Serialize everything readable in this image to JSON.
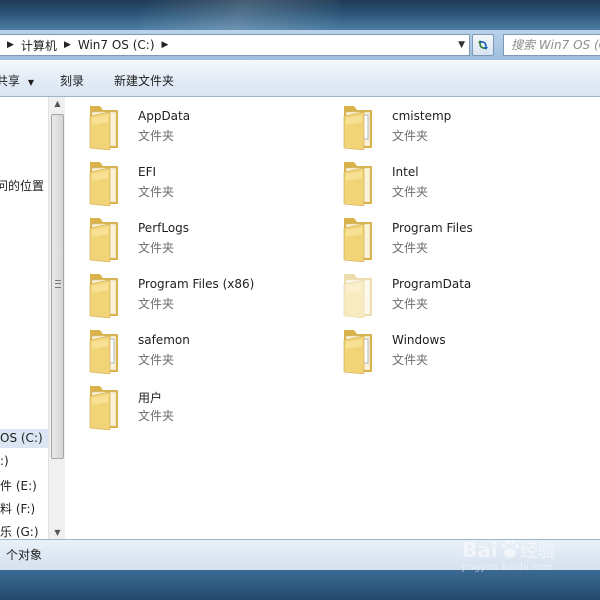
{
  "address_bar": {
    "crumbs": [
      "计算机",
      "Win7 OS (C:)"
    ],
    "search_placeholder": "搜索 Win7 OS (C:)"
  },
  "toolbar": {
    "share_label": "共享",
    "burn_label": "刻录",
    "new_folder_label": "新建文件夹"
  },
  "nav": {
    "partial_item": "问的位置",
    "drives": [
      {
        "label": "OS (C:)",
        "selected": true
      },
      {
        "label": ":)"
      },
      {
        "label": "件 (E:)"
      },
      {
        "label": "料 (F:)"
      },
      {
        "label": "乐 (G:)"
      }
    ]
  },
  "files": [
    {
      "name": "AppData",
      "type": "文件夹",
      "icon": "folder-icon"
    },
    {
      "name": "cmistemp",
      "type": "文件夹",
      "icon": "folder-with-document-icon"
    },
    {
      "name": "EFI",
      "type": "文件夹",
      "icon": "folder-icon"
    },
    {
      "name": "Intel",
      "type": "文件夹",
      "icon": "folder-icon"
    },
    {
      "name": "PerfLogs",
      "type": "文件夹",
      "icon": "folder-icon"
    },
    {
      "name": "Program Files",
      "type": "文件夹",
      "icon": "folder-icon"
    },
    {
      "name": "Program Files (x86)",
      "type": "文件夹",
      "icon": "folder-icon"
    },
    {
      "name": "ProgramData",
      "type": "文件夹",
      "icon": "hidden-folder-icon"
    },
    {
      "name": "safemon",
      "type": "文件夹",
      "icon": "folder-with-document-icon"
    },
    {
      "name": "Windows",
      "type": "文件夹",
      "icon": "folder-with-document-icon"
    },
    {
      "name": "用户",
      "type": "文件夹",
      "icon": "folder-icon"
    }
  ],
  "status_bar": {
    "text": "个对象"
  },
  "watermark": {
    "brand": "Bai度经验",
    "url": "jingyan.baidu.com"
  },
  "colors": {
    "folder_yellow": "#f2d478",
    "selection": "#dbe6f4",
    "toolbar_bg": "#e4ecf6"
  }
}
